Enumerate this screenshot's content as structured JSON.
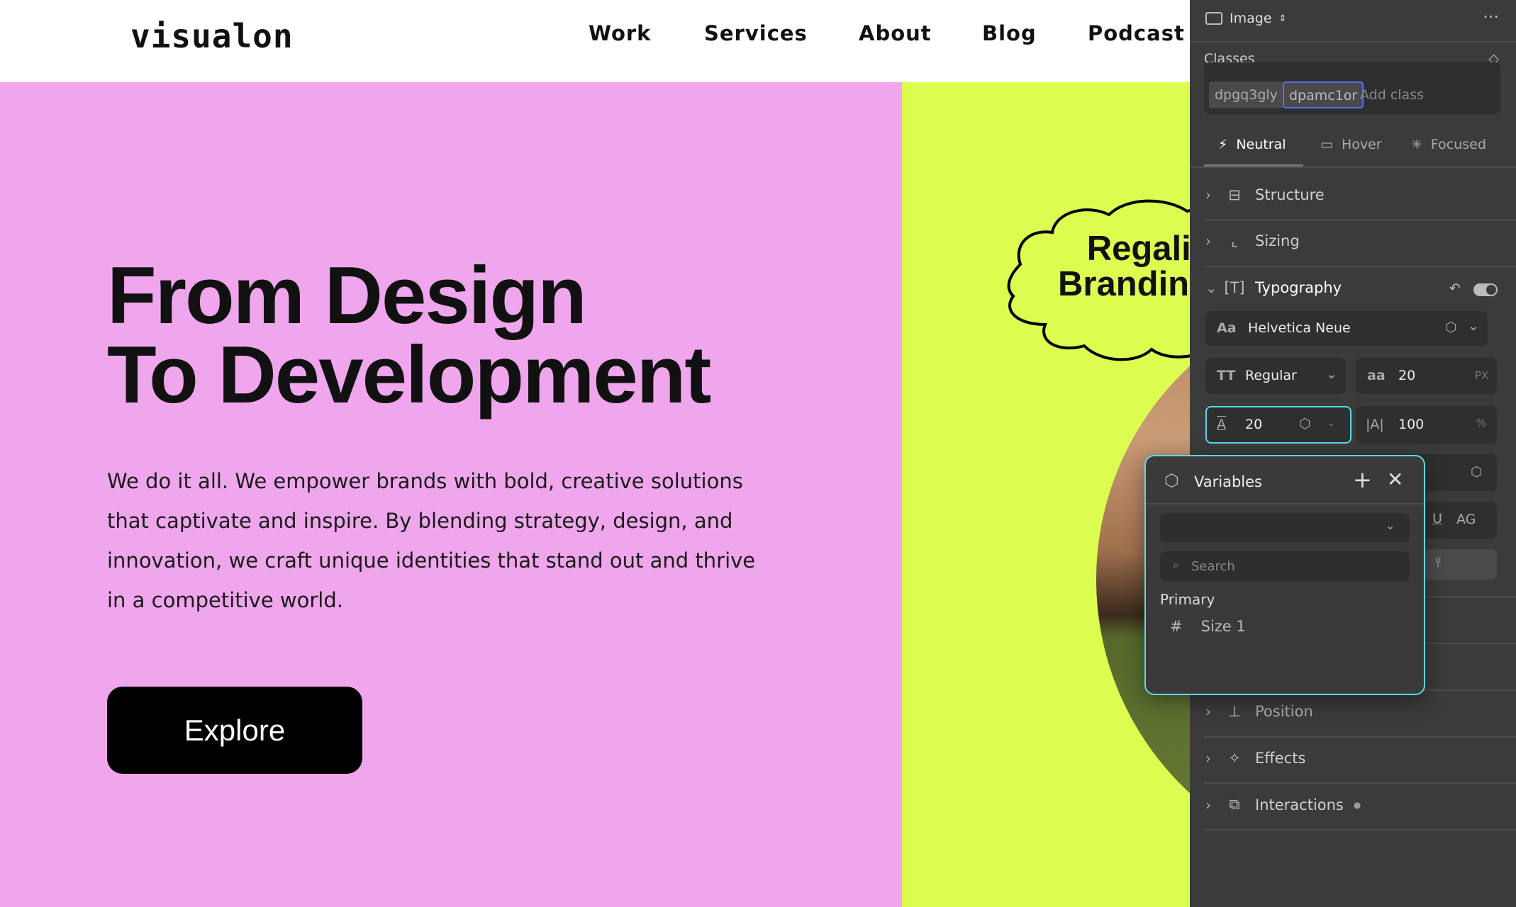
{
  "site": {
    "logo": "visualon",
    "nav": [
      "Work",
      "Services",
      "About",
      "Blog",
      "Podcast"
    ]
  },
  "hero": {
    "title_line1": "From Design",
    "title_line2": "To Development",
    "paragraph": "We do it all. We empower brands with bold, creative solutions that captivate and inspire. By blending strategy, design, and innovation, we craft unique identities that stand out and thrive in a competitive world.",
    "button": "Explore",
    "cloud_line1": "Regalia",
    "cloud_line2": "Branding"
  },
  "colors": {
    "pink": "#efa6ec",
    "lime": "#ddfc50",
    "panel": "#3b3b3b",
    "accent": "#5ad8e8"
  },
  "panel": {
    "element_type": "Image",
    "classes_label": "Classes",
    "classes": [
      "dpgq3gly",
      "dpamc1or"
    ],
    "add_class": "Add class",
    "states": [
      "Neutral",
      "Hover",
      "Focused"
    ],
    "sections": {
      "structure": "Structure",
      "sizing": "Sizing",
      "typography": "Typography",
      "position": "Position",
      "effects": "Effects",
      "interactions": "Interactions"
    },
    "typography": {
      "font": "Helvetica Neue",
      "weight": "Regular",
      "size": "20",
      "size_unit": "PX",
      "line_height": "20",
      "line_height_unit": "-",
      "letter_spacing": "100",
      "letter_spacing_unit": "%",
      "case_label": "AG",
      "underline_label": "U"
    }
  },
  "variables": {
    "title": "Variables",
    "search_placeholder": "Search",
    "group": "Primary",
    "items": [
      "Size 1"
    ]
  }
}
